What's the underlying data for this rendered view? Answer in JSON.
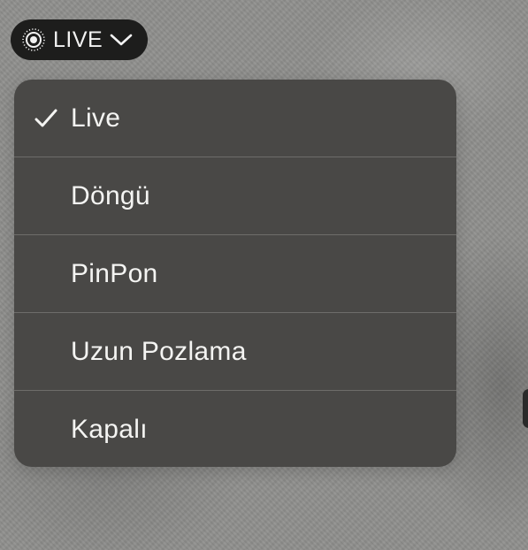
{
  "live_button": {
    "label": "LIVE",
    "icon": "live-photo-icon",
    "dropdown_icon": "chevron-down-icon"
  },
  "menu": {
    "selected_index": 0,
    "items": [
      {
        "label": "Live",
        "checked": true
      },
      {
        "label": "Döngü",
        "checked": false
      },
      {
        "label": "PinPon",
        "checked": false
      },
      {
        "label": "Uzun Pozlama",
        "checked": false
      },
      {
        "label": "Kapalı",
        "checked": false
      }
    ]
  },
  "colors": {
    "pill_bg": "#1d1d1c",
    "menu_bg": "#494846",
    "separator": "#6e6d6a",
    "text": "#f4f4f2",
    "background": "#8e8e8c"
  }
}
